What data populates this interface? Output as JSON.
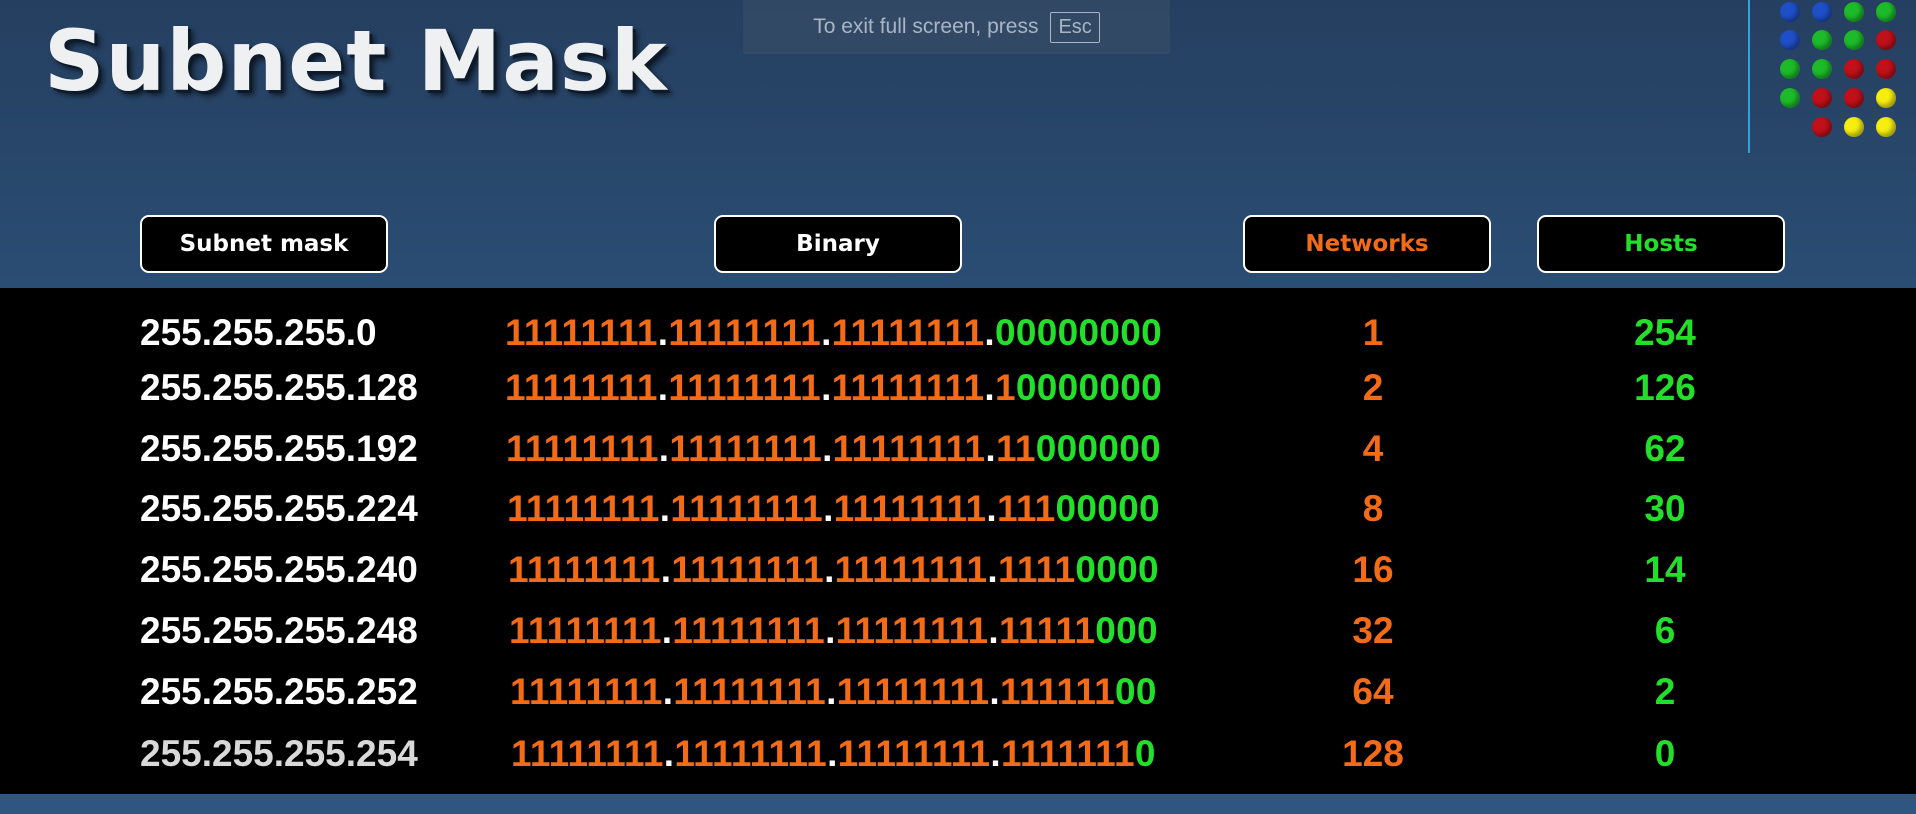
{
  "app": {
    "title": "Subnet Mask"
  },
  "fullscreen_banner": {
    "text": "To exit full screen, press",
    "key": "Esc"
  },
  "decor_dots": {
    "colors": {
      "blue": "#1f4fc8",
      "green": "#1dbb2a",
      "red": "#c0101a",
      "yellow": "#f7ee10"
    },
    "rows": [
      [
        "blue",
        "blue",
        "green",
        "green"
      ],
      [
        "blue",
        "green",
        "green",
        "red"
      ],
      [
        "green",
        "green",
        "red",
        "red"
      ],
      [
        "green",
        "red",
        "red",
        "yellow"
      ],
      [
        null,
        "red",
        "yellow",
        "yellow"
      ]
    ]
  },
  "headers": {
    "subnet_mask": "Subnet mask",
    "binary": "Binary",
    "networks": "Networks",
    "hosts": "Hosts"
  },
  "colors": {
    "network_bits": "#f36b16",
    "host_bits": "#22e02a",
    "text": "#ffffff",
    "background_panel": "#000000"
  },
  "rows": [
    {
      "mask": "255.255.255.0",
      "binary": "11111111.11111111.11111111.00000000",
      "networks": "1",
      "hosts": "254"
    },
    {
      "mask": "255.255.255.128",
      "binary": "11111111.11111111.11111111.10000000",
      "networks": "2",
      "hosts": "126"
    },
    {
      "mask": "255.255.255.192",
      "binary": "11111111.11111111.11111111.11000000",
      "networks": "4",
      "hosts": "62"
    },
    {
      "mask": "255.255.255.224",
      "binary": "11111111.11111111.11111111.11100000",
      "networks": "8",
      "hosts": "30"
    },
    {
      "mask": "255.255.255.240",
      "binary": "11111111.11111111.11111111.11110000",
      "networks": "16",
      "hosts": "14"
    },
    {
      "mask": "255.255.255.248",
      "binary": "11111111.11111111.11111111.11111000",
      "networks": "32",
      "hosts": "6"
    },
    {
      "mask": "255.255.255.252",
      "binary": "11111111.11111111.11111111.11111100",
      "networks": "64",
      "hosts": "2"
    },
    {
      "mask": "255.255.255.254",
      "binary": "11111111.11111111.11111111.11111110",
      "networks": "128",
      "hosts": "0"
    }
  ]
}
